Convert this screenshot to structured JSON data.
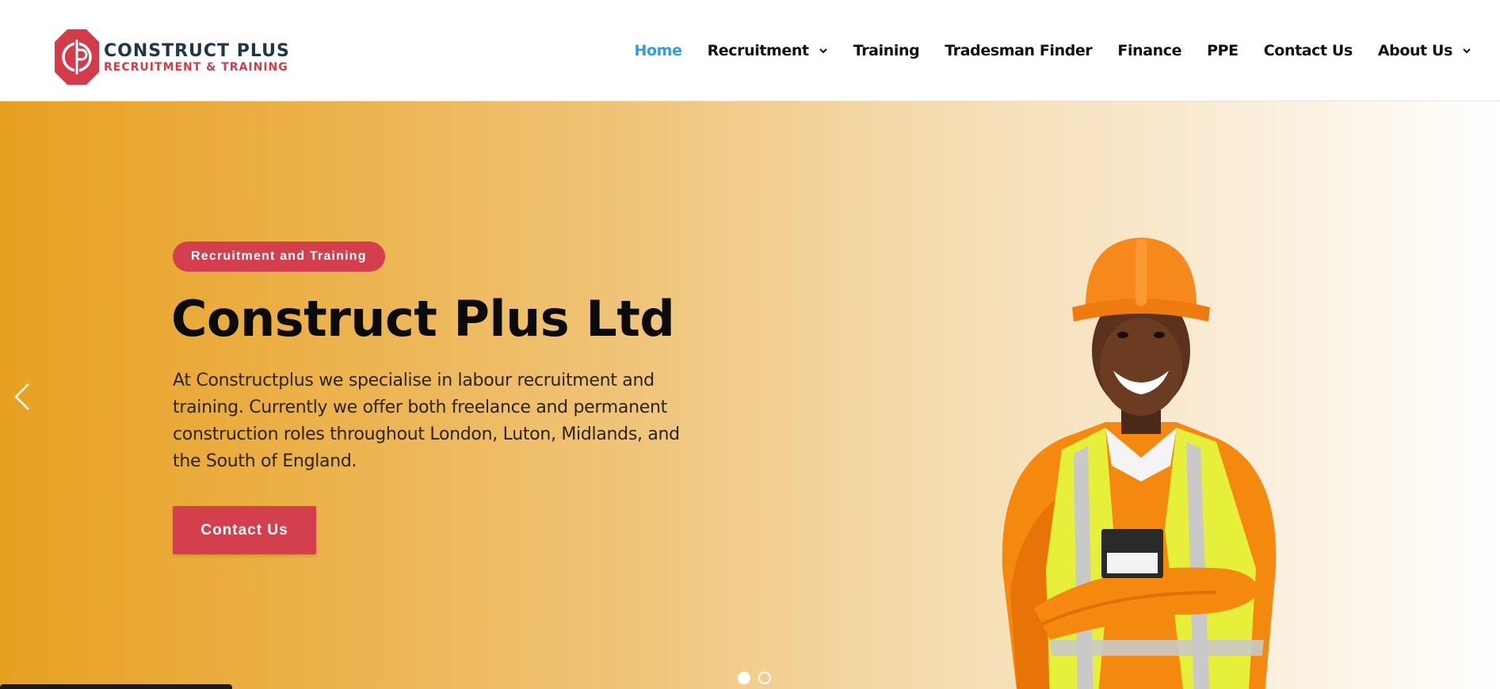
{
  "header": {
    "logo": {
      "title": "CONSTRUCT PLUS",
      "subtitle": "RECRUITMENT & TRAINING",
      "mark_letters": "CP",
      "brand_red": "#d33a4a",
      "brand_navy": "#1f3548"
    },
    "nav": [
      {
        "label": "Home",
        "active": true
      },
      {
        "label": "Recruitment",
        "dropdown": true,
        "icon": "chevron-down-icon"
      },
      {
        "label": "Training"
      },
      {
        "label": "Tradesman Finder"
      },
      {
        "label": "Finance"
      },
      {
        "label": "PPE"
      },
      {
        "label": "Contact Us"
      },
      {
        "label": "About Us",
        "dropdown": true,
        "icon": "chevron-down-icon"
      }
    ],
    "active_color": "#2d9ee6"
  },
  "hero": {
    "badge": "Recruitment and Training",
    "title": "Construct Plus Ltd",
    "description": "At Constructplus we specialise in labour recruitment and training. Currently we offer both freelance and permanent construction roles throughout London, Luton, Midlands, and the South of England.",
    "cta_label": "Contact Us",
    "prev_icon": "chevron-left-icon",
    "image": "construction-worker-hard-hat-hi-vis",
    "slides": {
      "count": 2,
      "current": 1
    },
    "accent_color": "#d33f4c",
    "gradient_start": "#e8a020"
  }
}
